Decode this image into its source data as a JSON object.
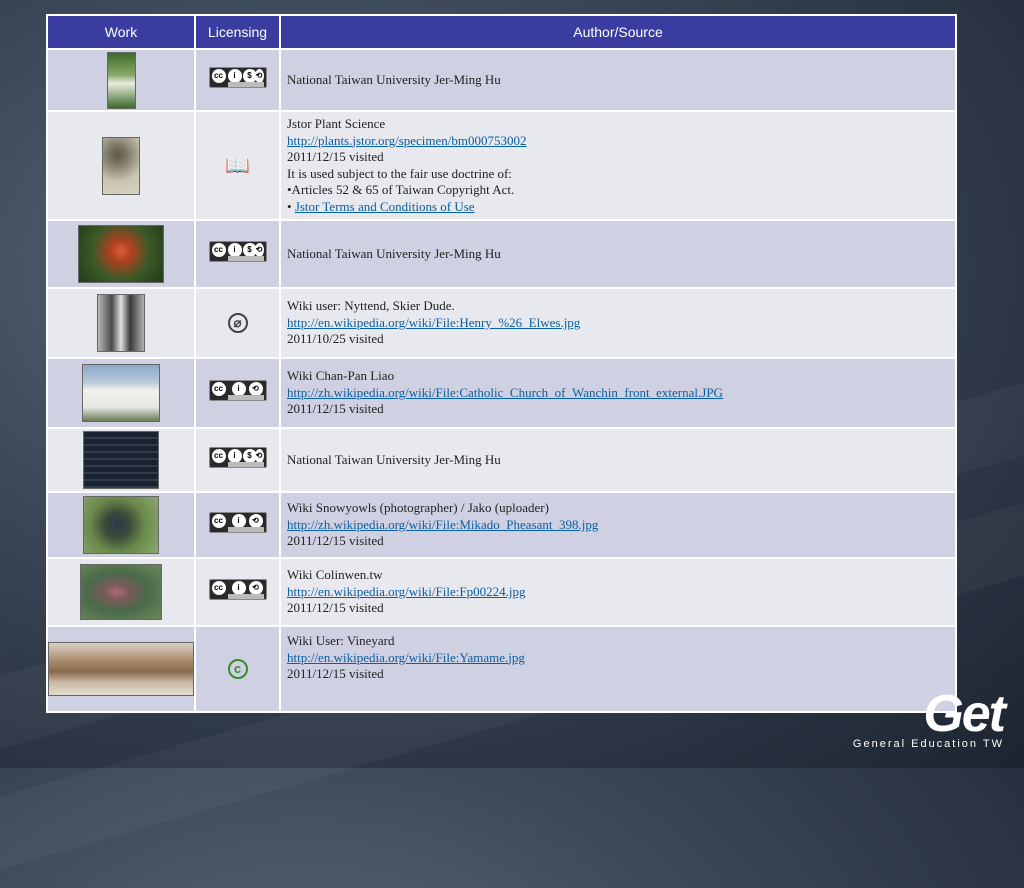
{
  "header": {
    "work": "Work",
    "licensing": "Licensing",
    "author": "Author/Source"
  },
  "rows": [
    {
      "license": "BY-NC-SA",
      "lines": [
        "National Taiwan University Jer-Ming Hu"
      ],
      "links": []
    },
    {
      "license": "fair-use-icon",
      "lines": [
        "Jstor Plant Science",
        "2011/12/15 visited",
        "It is used subject to the fair use doctrine of:",
        "•Articles 52 & 65 of Taiwan Copyright Act.",
        "•"
      ],
      "links": [
        "http://plants.jstor.org/specimen/bm000753002",
        "Jstor Terms and Conditions of Use"
      ]
    },
    {
      "license": "BY-NC-SA",
      "lines": [
        "National Taiwan University Jer-Ming Hu"
      ],
      "links": []
    },
    {
      "license": "public-domain-icon",
      "lines": [
        "Wiki user: Nyttend, Skier Dude.",
        "2011/10/25 visited"
      ],
      "links": [
        "http://en.wikipedia.org/wiki/File:Henry_%26_Elwes.jpg"
      ]
    },
    {
      "license": "BY-SA",
      "lines": [
        "Wiki Chan-Pan Liao",
        "2011/12/15 visited"
      ],
      "links": [
        "http://zh.wikipedia.org/wiki/File:Catholic_Church_of_Wanchin_front_external.JPG"
      ]
    },
    {
      "license": "BY-NC-SA",
      "lines": [
        "National Taiwan University Jer-Ming Hu"
      ],
      "links": []
    },
    {
      "license": "BY-SA",
      "lines": [
        "Wiki Snowyowls (photographer) / Jako (uploader)",
        "2011/12/15 visited"
      ],
      "links": [
        "http://zh.wikipedia.org/wiki/File:Mikado_Pheasant_398.jpg"
      ]
    },
    {
      "license": "BY-SA",
      "lines": [
        "Wiki Colinwen.tw",
        "2011/12/15 visited"
      ],
      "links": [
        "http://en.wikipedia.org/wiki/File:Fp00224.jpg"
      ]
    },
    {
      "license": "copyright-icon",
      "lines": [
        "Wiki User: Vineyard",
        "2011/12/15 visited"
      ],
      "links": [
        "http://en.wikipedia.org/wiki/File:Yamame.jpg"
      ]
    }
  ],
  "logo": {
    "mark": "Get",
    "subtitle": "General Education TW"
  },
  "colors": {
    "header_bg": "#3b3c9f",
    "row_odd": "#cfd0e2",
    "row_even": "#e8e8ef",
    "link": "#0a5fa0"
  }
}
